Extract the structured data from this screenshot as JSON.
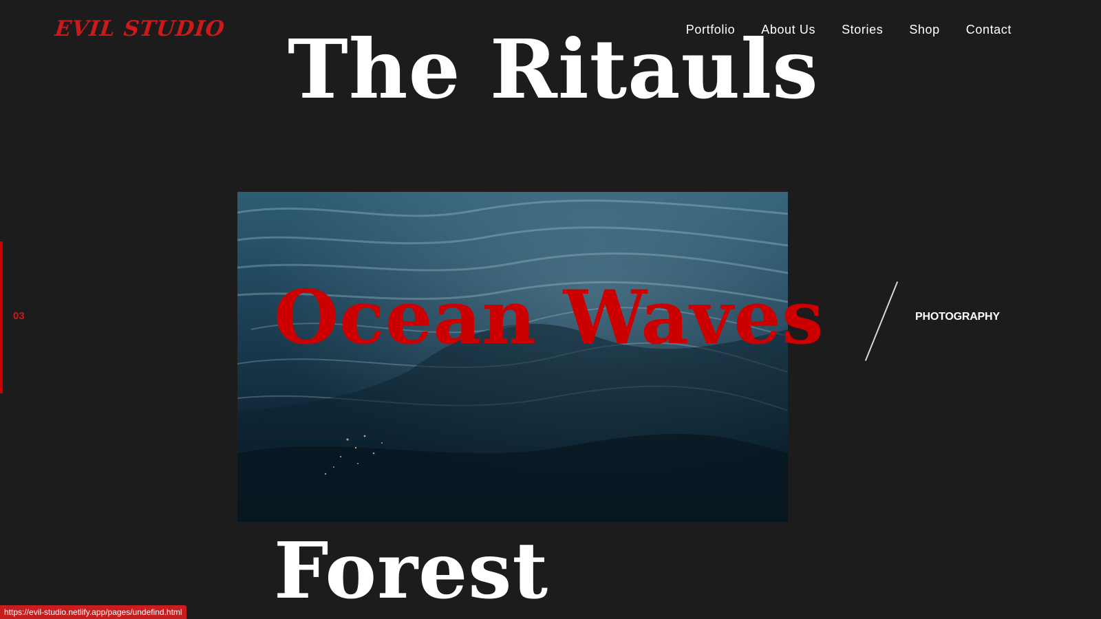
{
  "header": {
    "logo": "EVIL STUDIO",
    "nav": [
      {
        "label": "Portfolio"
      },
      {
        "label": "About Us"
      },
      {
        "label": "Stories"
      },
      {
        "label": "Shop"
      },
      {
        "label": "Contact"
      }
    ]
  },
  "slider": {
    "previous_title": "The Ritauls",
    "current_title": "Ocean Waves",
    "next_title": "Forest",
    "current_index": "03",
    "category": "PHOTOGRAPHY",
    "image": "ocean-waves-photo"
  },
  "status_bar": {
    "url": "https://evil-studio.netlify.app/pages/undefind.html"
  },
  "colors": {
    "background": "#1c1c1c",
    "accent": "#cc0000",
    "text": "#ffffff"
  }
}
